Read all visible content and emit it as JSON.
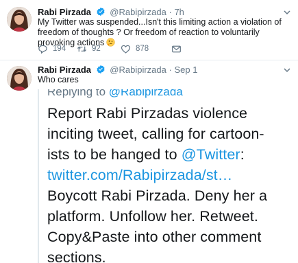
{
  "tweets": [
    {
      "name": "Rabi Pirzada",
      "handle": "@Rabipirzada",
      "separator": "·",
      "time": "7h",
      "text": "My Twitter was suspended...Isn't this limiting action a violation of freedom of thoughts ? Or freedom of reaction to voluntarily provoking actions",
      "emoji": "thinking-face",
      "stats": {
        "replies": "194",
        "retweets": "92",
        "likes": "878"
      }
    },
    {
      "name": "Rabi Pirzada",
      "handle": "@Rabipirzada",
      "separator": "·",
      "time": "Sep 1",
      "text": "Who cares",
      "embedded": {
        "reply_prefix": "Replying to",
        "reply_handle": "@Rabipirzada",
        "lines": [
          "Report Rabi Pirzadas violence",
          "inciting tweet, calling for cartoon-",
          "ists to  be hanged to ",
          "twitter.com/Rabipirzada/st…",
          "Boycott Rabi  Pirzada. Deny her a",
          "platform. Unfollow her. Retweet.",
          "Copy&Paste into  other comment",
          "sections."
        ],
        "mention": "@Twitter",
        "mention_suffix": ":"
      }
    }
  ],
  "colors": {
    "link": "#1b95e0",
    "muted": "#657786",
    "verified": "#1da1f2",
    "divider": "#e6ecf0"
  },
  "icons": [
    "verified-badge-icon",
    "chevron-down-icon",
    "reply-icon",
    "retweet-icon",
    "like-icon",
    "direct-message-icon",
    "thinking-face-emoji"
  ]
}
